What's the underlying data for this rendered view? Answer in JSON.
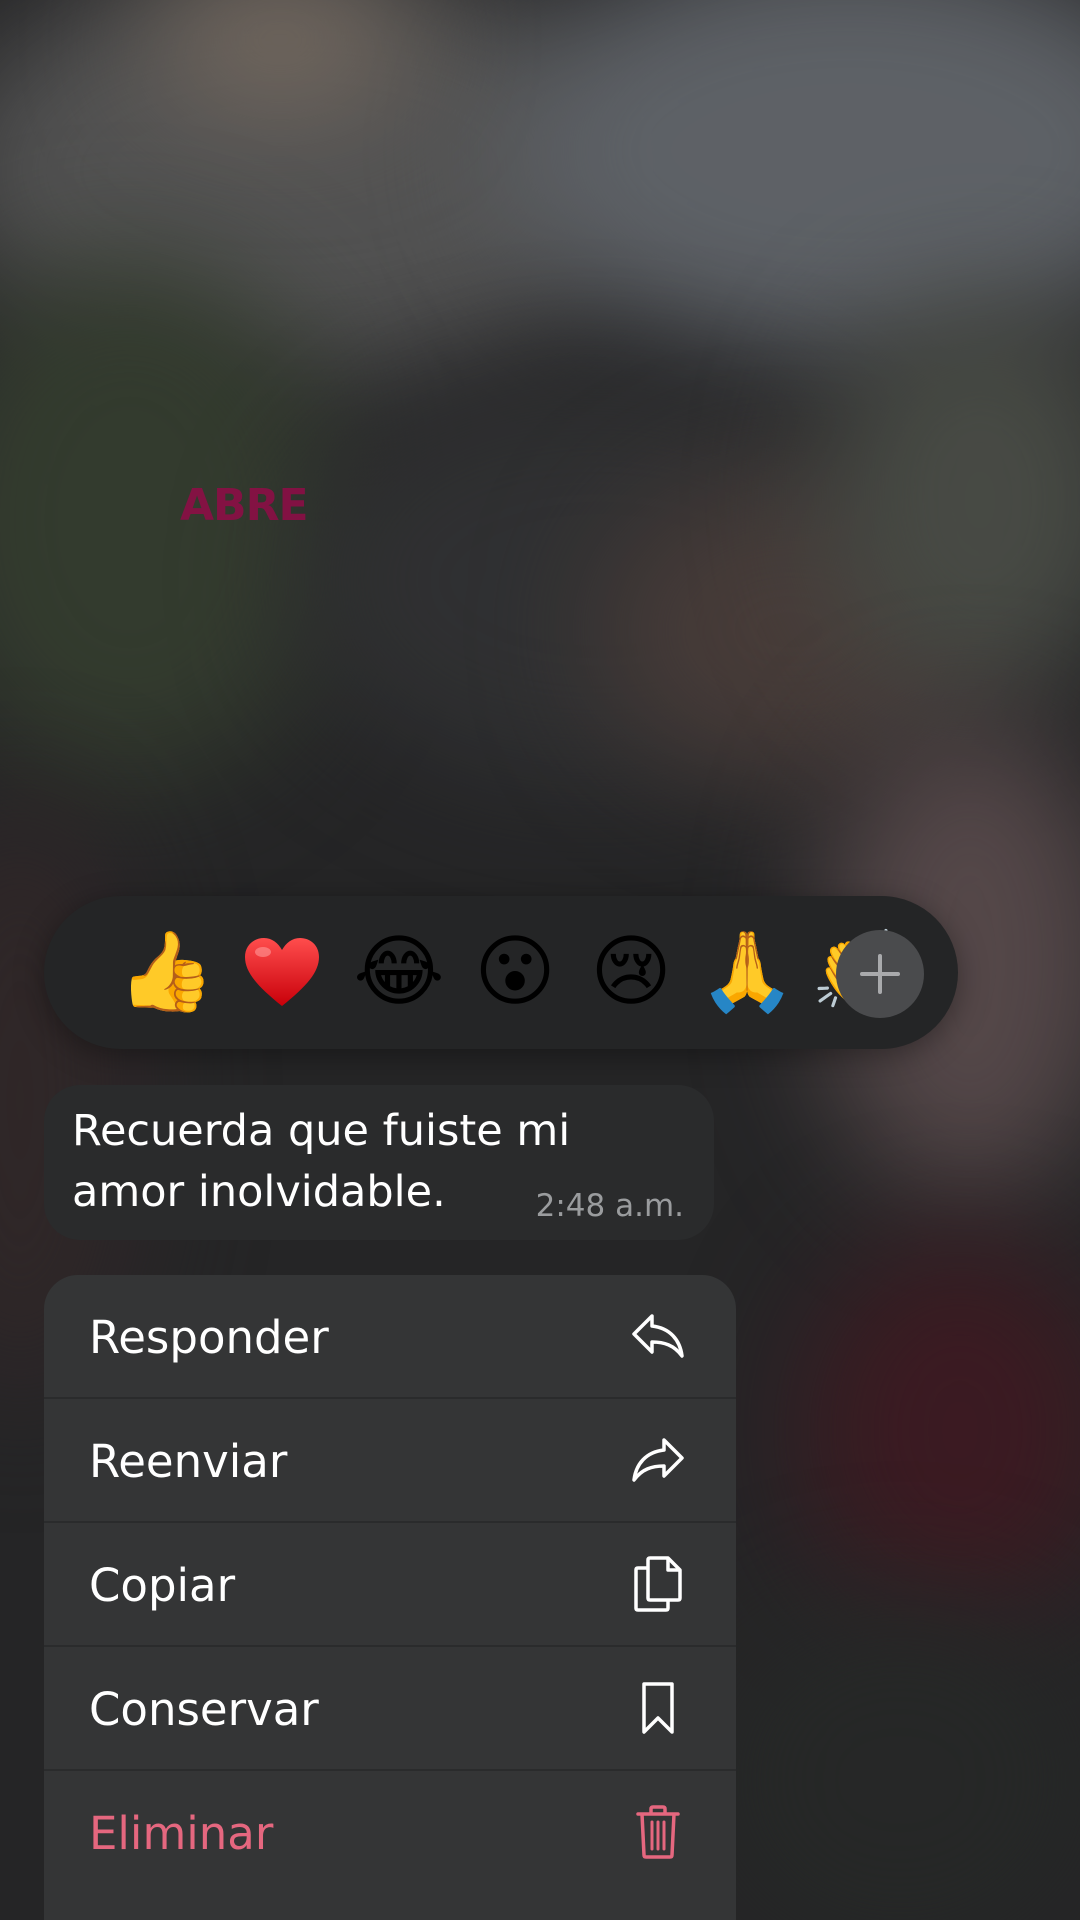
{
  "background_text": "ABRE",
  "reactions": [
    {
      "emoji": "👍",
      "name": "thumbs-up"
    },
    {
      "emoji": "❤",
      "name": "heart"
    },
    {
      "emoji": "😂",
      "name": "laughing"
    },
    {
      "emoji": "😮",
      "name": "surprised"
    },
    {
      "emoji": "😢",
      "name": "crying"
    },
    {
      "emoji": "🙏",
      "name": "praying-hands"
    },
    {
      "emoji": "👏",
      "name": "clapping"
    }
  ],
  "message": {
    "text": "Recuerda que fuiste mi amor inolvidable.",
    "time": "2:48 a.m."
  },
  "menu": {
    "reply": "Responder",
    "forward": "Reenviar",
    "copy": "Copiar",
    "keep": "Conservar",
    "delete": "Eliminar"
  },
  "colors": {
    "danger": "#e5677f",
    "menu_bg": "#343536",
    "bubble_bg": "#2a2b2c",
    "accent_text": "#8a0f45"
  }
}
